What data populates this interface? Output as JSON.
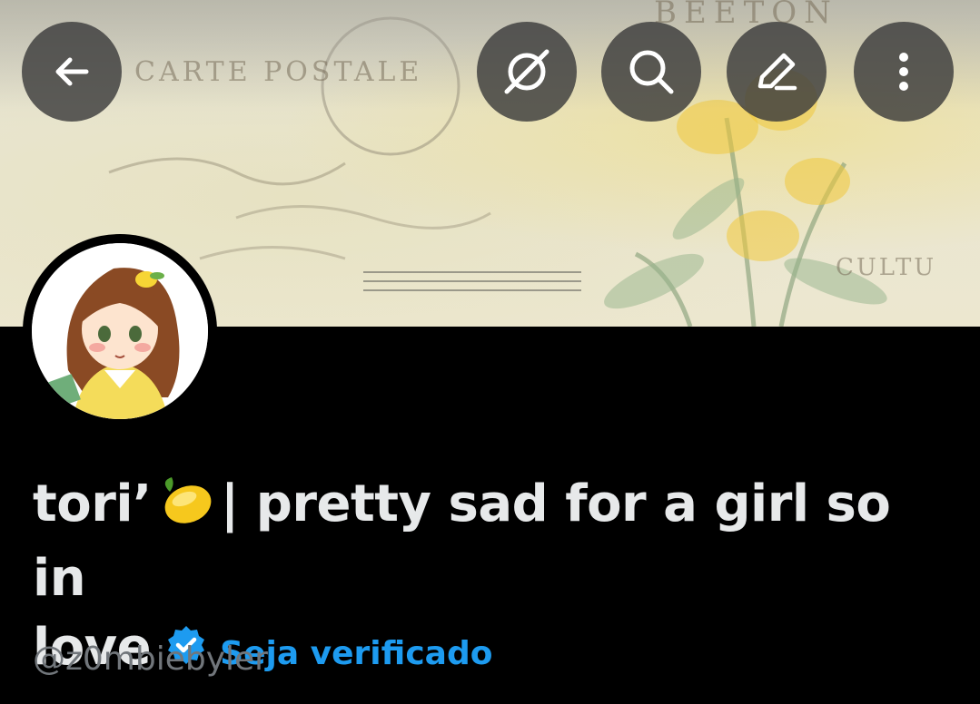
{
  "banner": {
    "texts": [
      "CARTE POSTALE",
      "BEETON",
      "CULTU"
    ]
  },
  "toolbar": {
    "back_icon": "arrow-left-icon",
    "grok_icon": "grok-icon",
    "search_icon": "search-icon",
    "edit_icon": "pencil-icon",
    "more_icon": "more-vertical-icon"
  },
  "profile": {
    "name_part1": "tori’",
    "name_emoji": "lemon",
    "name_part2": "| pretty sad for a girl so in",
    "name_line2": "love",
    "get_verified": "Seja verificado",
    "handle": "@z0mbiebyler"
  },
  "colors": {
    "accent": "#1d9bf0",
    "text": "#e7e9ea",
    "muted": "#71767b",
    "background": "#000000"
  }
}
